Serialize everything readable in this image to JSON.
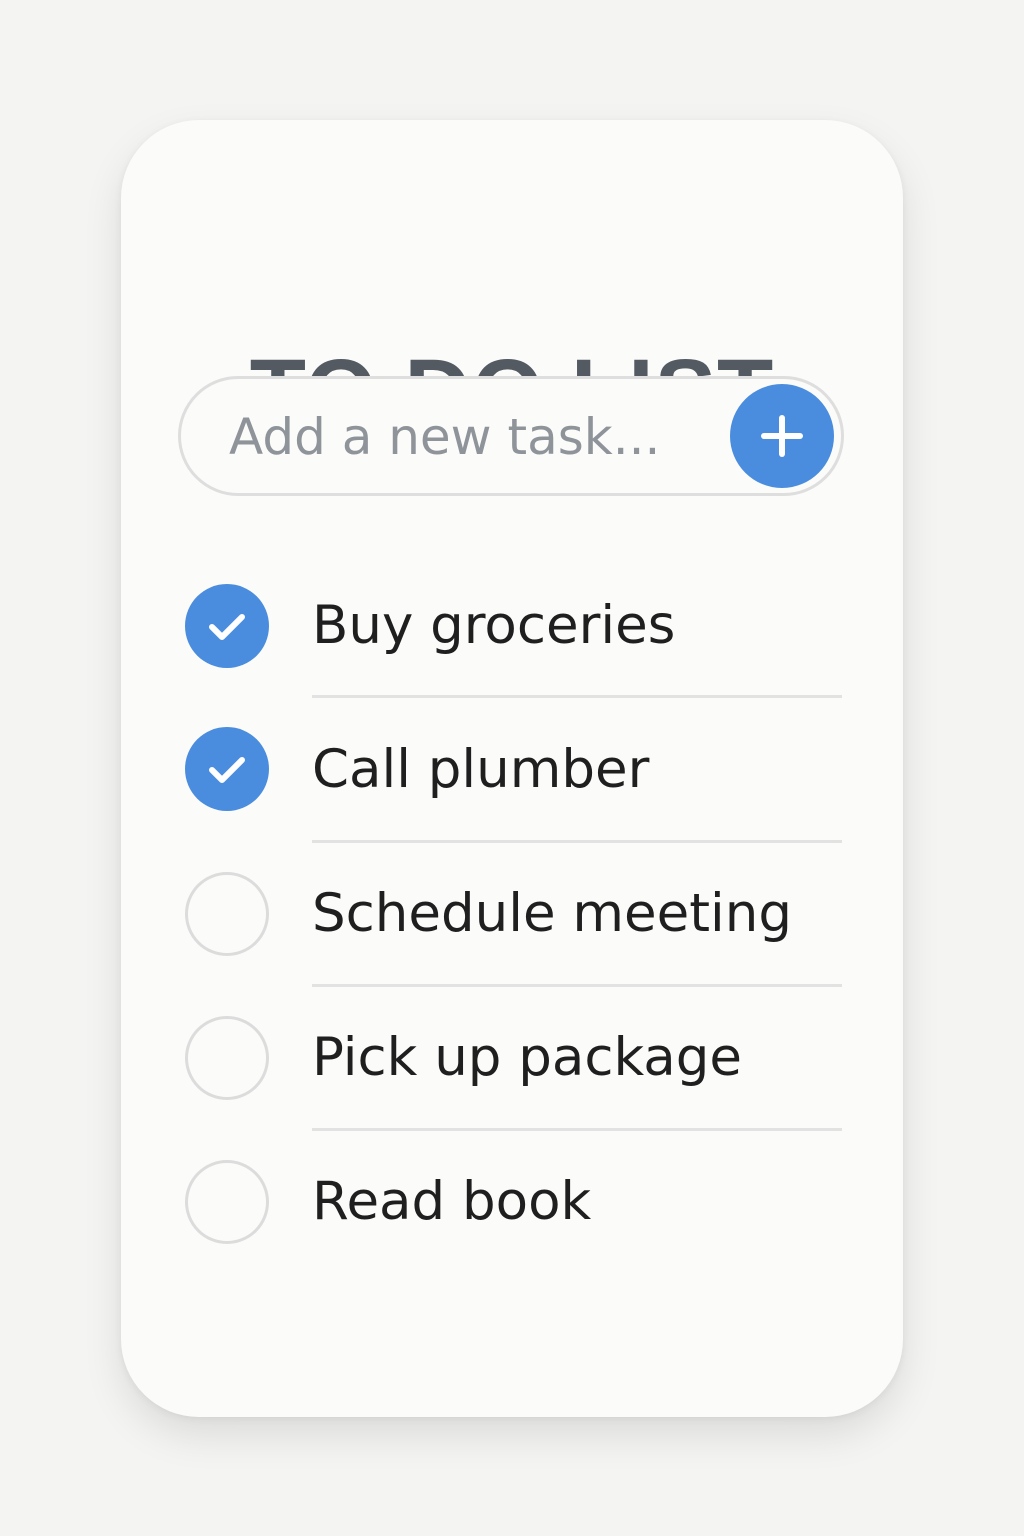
{
  "app": {
    "title": "TO DO LIST"
  },
  "input": {
    "placeholder": "Add a new task...",
    "value": ""
  },
  "add_button": {
    "icon": "plus-icon"
  },
  "colors": {
    "accent": "#4a8dde",
    "title": "#535a62",
    "text": "#1f1f1f",
    "divider": "#e2e2e2",
    "unchecked_border": "#dcdcdc"
  },
  "tasks": [
    {
      "label": "Buy groceries",
      "checked": true
    },
    {
      "label": "Call plumber",
      "checked": true
    },
    {
      "label": "Schedule meeting",
      "checked": false
    },
    {
      "label": "Pick up package",
      "checked": false
    },
    {
      "label": "Read book",
      "checked": false
    }
  ]
}
